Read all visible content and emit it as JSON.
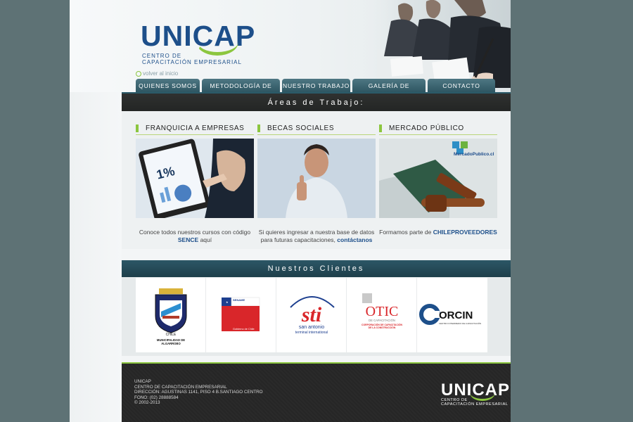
{
  "header": {
    "logo_main": "UNICAP",
    "logo_sub_1": "Centro de",
    "logo_sub_2": "Capacitación Empresarial",
    "volver": "volver al inicio"
  },
  "nav": [
    {
      "label": "Quienes Somos"
    },
    {
      "label": "Metodología de Trabajo"
    },
    {
      "label": "Nuestro Trabajo"
    },
    {
      "label": "Galería de Imágenes"
    },
    {
      "label": "Contacto"
    }
  ],
  "areas_title": "Áreas de Trabajo:",
  "areas": [
    {
      "title": "Franquicia a Empresas",
      "text_1": "Conoce todos nuestros cursos con código",
      "text_bold": "SENCE",
      "text_2": "aquí"
    },
    {
      "title": "Becas Sociales",
      "text_1": "Si quieres ingresar a nuestra base de datos",
      "text_2": "para futuras capacitaciones,",
      "text_bold": "contáctanos"
    },
    {
      "title": "Mercado Público",
      "text_1": "Formamos parte de",
      "text_bold": "CHILEPROVEEDORES",
      "logo_text": "MercadoPublico.cl"
    }
  ],
  "clients_title": "Nuestros Clientes",
  "clients": [
    {
      "name": "Municipalidad de Algarrobo",
      "line1": "MUNICIPALIDAD DE",
      "line2": "ALGARROBO",
      "crest_text": "CHILE"
    },
    {
      "name": "Sename",
      "line1": "SENAME",
      "line2": "Gobierno de Chile"
    },
    {
      "name": "STI",
      "logo": "sti",
      "line1": "san antonio",
      "line2": "terminal international"
    },
    {
      "name": "OTIC",
      "logo": "OTIC",
      "line1": "DE CAPACITACIÓN",
      "line2": "CORPORACIÓN DE CAPACITACIÓN",
      "line3": "DE LA CONSTRUCCIÓN"
    },
    {
      "name": "Corcin",
      "logo": "ORCIN",
      "line1": "CENTRO INTERMEDIO DE CAPACITACIÓN"
    }
  ],
  "footer": {
    "line1": "UNICAP",
    "line2": "CENTRO DE CAPACITACIÓN EMPRESARIAL",
    "line3": "DIRECCIÓN: AGUSTINAS 1141, PISO 4 B.SANTIAGO CENTRO",
    "line4": "FONO: (02) 28888584",
    "line5": "© 2002-2013",
    "logo": "UNICAP",
    "logo_sub_1": "Centro de",
    "logo_sub_2": "Capacitación Empresarial"
  },
  "colors": {
    "brand_blue": "#1d4f8a",
    "accent_green": "#8cc63f",
    "nav_teal": "#3e6773",
    "band_dark": "#2a2c2b"
  }
}
